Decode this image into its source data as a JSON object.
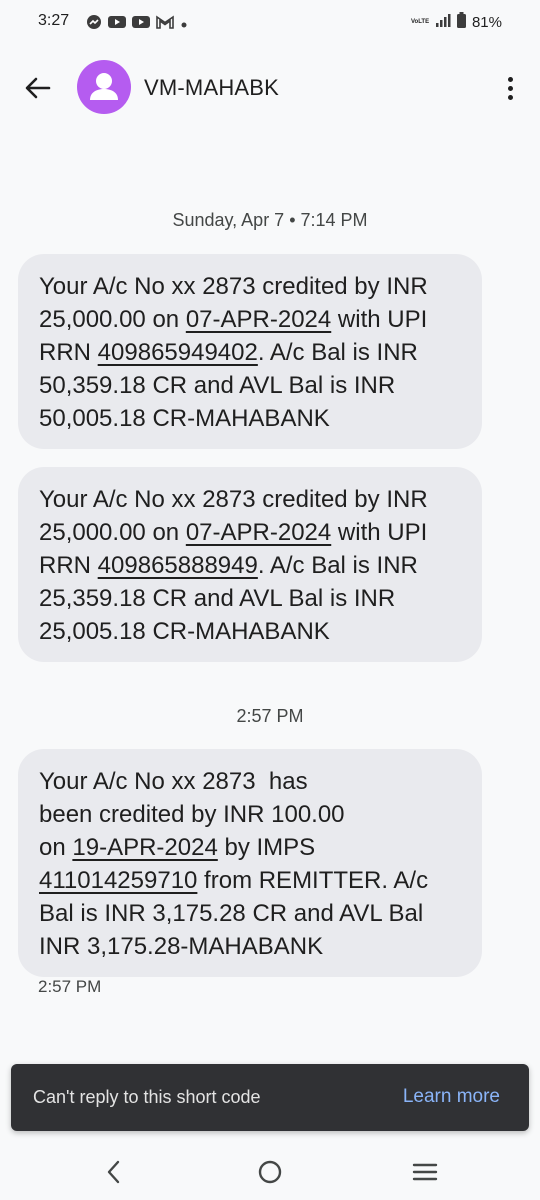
{
  "status_bar": {
    "time": "3:27",
    "battery": "81%",
    "network_label": "VoLTE"
  },
  "header": {
    "contact_name": "VM-MAHABK"
  },
  "conversation": {
    "date_separator": "Sunday, Apr 7 • 7:14 PM",
    "messages": [
      {
        "p1": "Your A/c No xx 2873 credited by INR 25,000.00 on ",
        "date": "07-APR-2024",
        "p2": " with UPI RRN ",
        "ref": "409865949402",
        "p3": ". A/c Bal is INR 50,359.18 CR and AVL Bal is INR 50,005.18 CR-MAHABANK"
      },
      {
        "p1": "Your A/c No xx 2873 credited by INR 25,000.00 on ",
        "date": "07-APR-2024",
        "p2": " with UPI RRN ",
        "ref": "409865888949",
        "p3": ". A/c Bal is INR 25,359.18 CR and AVL Bal is INR 25,005.18 CR-MAHABANK"
      }
    ],
    "time_separator": "2:57 PM",
    "message3": {
      "line1": "Your A/c No xx 2873  has",
      "line2": "been credited by INR 100.00",
      "on": "on ",
      "date": "19-APR-2024",
      "by": " by IMPS",
      "ref": "411014259710",
      "p3": " from REMITTER. A/c",
      "line5": "Bal is INR 3,175.28 CR and AVL Bal",
      "line6": "INR 3,175.28-MAHABANK"
    },
    "last_message_time": "2:57 PM"
  },
  "snackbar": {
    "text": "Can't reply to this short code",
    "action": "Learn more"
  },
  "colors": {
    "avatar": "#b55cf0",
    "bubble": "#e9eaee",
    "snackbar_bg": "#303134",
    "snackbar_action": "#8ab4f8"
  },
  "icons": {
    "status_left": [
      "messenger-icon",
      "youtube-icon",
      "youtube-icon",
      "gmail-icon",
      "dot-icon"
    ],
    "status_right": [
      "volte-icon",
      "signal-icon",
      "battery-icon"
    ],
    "nav": [
      "back-icon",
      "home-icon",
      "recents-icon"
    ]
  }
}
